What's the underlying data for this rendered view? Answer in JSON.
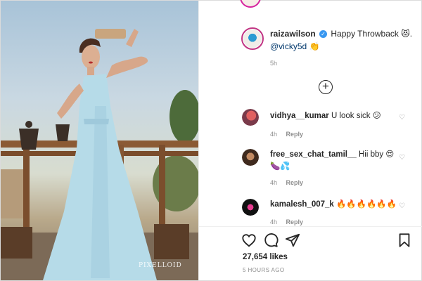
{
  "post": {
    "photo_watermark": "PIXELLOID",
    "author": "raizawilson",
    "caption_text": "Happy Throwback",
    "caption_emoji": "😻.",
    "mention": "@vicky5d",
    "mention_emoji": "👏",
    "age": "5h",
    "load_more_symbol": "+",
    "likes": "27,654 likes",
    "timestamp": "5 HOURS AGO"
  },
  "comments": [
    {
      "user": "vidhya__kumar",
      "text": "U look sick 😕",
      "age": "4h",
      "reply": "Reply"
    },
    {
      "user": "free_sex_chat_tamil__",
      "text": "Hii bby 😍",
      "text2": "🍆💦",
      "age": "4h",
      "reply": "Reply"
    },
    {
      "user": "kamalesh_007_k",
      "text": "🔥🔥🔥🔥🔥🔥",
      "age": "4h",
      "reply": "Reply"
    }
  ],
  "icons": {
    "verified": "✓",
    "heart": "♡",
    "like": "heart-icon",
    "comment": "comment-icon",
    "share": "share-icon",
    "save": "bookmark-icon"
  },
  "colors": {
    "accent": "#3897f0",
    "ring": "#c13584",
    "muted": "#8e8e8e",
    "text": "#262626",
    "mention": "#00376b"
  }
}
